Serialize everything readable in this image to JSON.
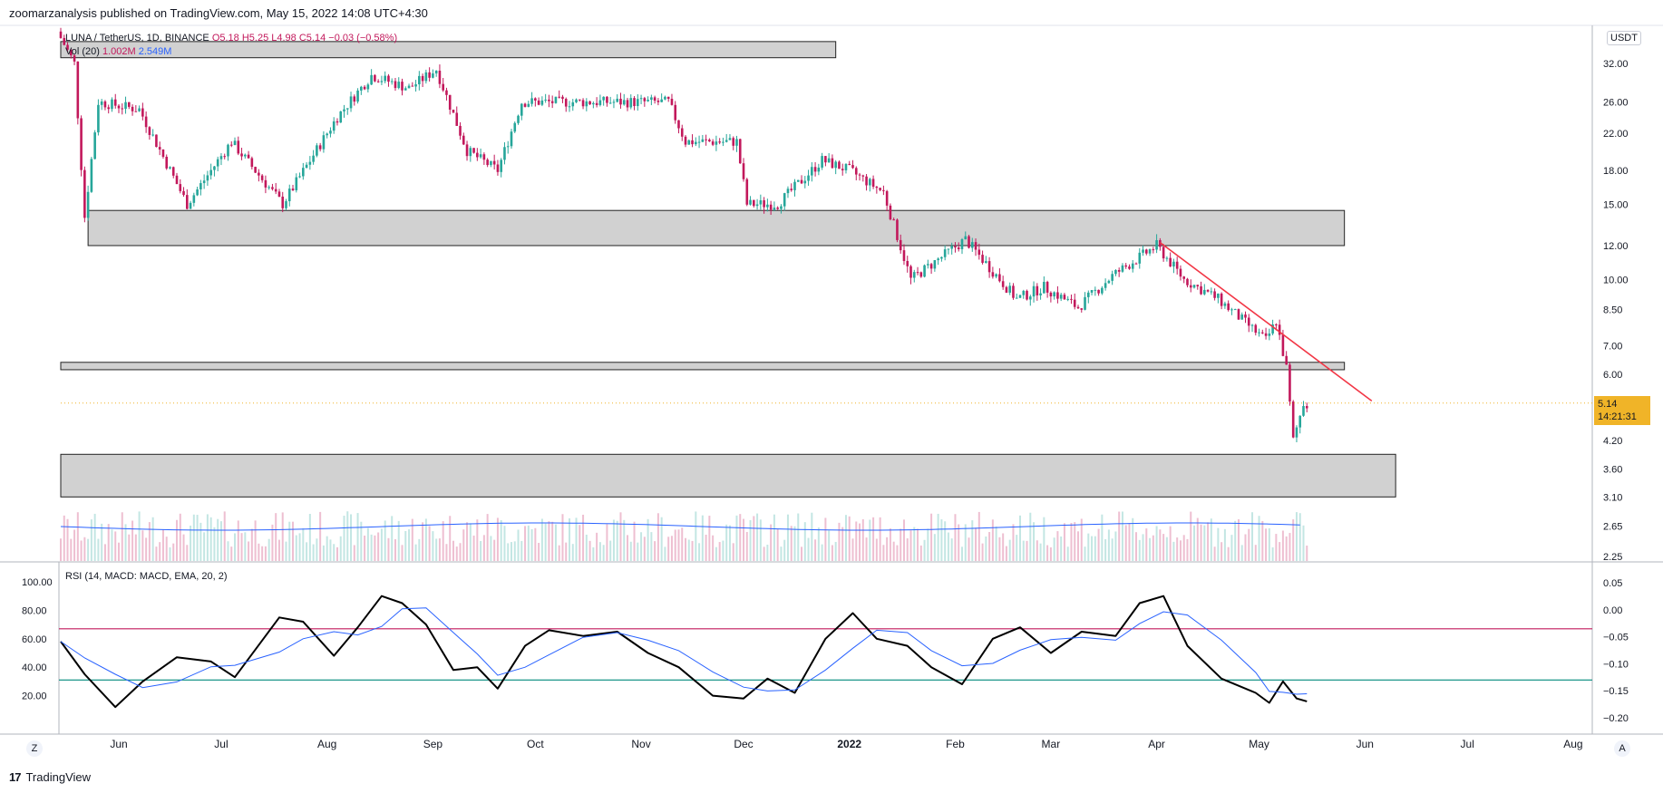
{
  "header": {
    "publisher_line": "zoomarzanalysis published on TradingView.com, May 15, 2022 14:08 UTC+4:30"
  },
  "legend": {
    "symbol": "LUNA / TetherUS, 1D, BINANCE",
    "open": "O5.18",
    "high": "H5.25",
    "low": "L4.98",
    "close": "C5.14",
    "change": "−0.03 (−0.58%)",
    "vol_label": "Vol (20)",
    "vol_value": "1.002M",
    "vol_ma": "2.549M",
    "rsi_label": "RSI (14, MACD: MACD, EMA, 20, 2)"
  },
  "price_axis": {
    "currency": "USDT",
    "last_price": "5.14",
    "countdown": "14:21:31",
    "tick_labels": [
      "32.00",
      "26.00",
      "22.00",
      "18.00",
      "15.00",
      "12.00",
      "10.00",
      "8.50",
      "7.00",
      "6.00",
      "4.20",
      "3.60",
      "3.10",
      "2.65",
      "2.25"
    ]
  },
  "rsi_axis": {
    "left_labels": [
      "100.00",
      "80.00",
      "60.00",
      "40.00",
      "20.00"
    ],
    "right_labels": [
      "0.05",
      "0.00",
      "−0.05",
      "−0.10",
      "−0.15",
      "−0.20"
    ]
  },
  "time_axis": {
    "labels": [
      "Jun",
      "Jul",
      "Aug",
      "Sep",
      "Oct",
      "Nov",
      "Dec",
      "2022",
      "Feb",
      "Mar",
      "Apr",
      "May",
      "Jun",
      "Jul",
      "Aug"
    ]
  },
  "footer": {
    "brand": "TradingView",
    "mark": "17",
    "z_button": "Z",
    "a_button": "A"
  },
  "colors": {
    "up": "#26a69a",
    "down": "#c2185b",
    "trendline": "#f23645",
    "zone_fill": "#d1d1d1",
    "rsi_line": "#000000",
    "rsi_ma": "#2962ff",
    "vol_ma": "#2962ff",
    "level_upper": "#c2185b",
    "level_lower": "#00897b",
    "last_price": "#f0b428"
  },
  "chart_data": {
    "type": "candlestick",
    "title": "LUNA / TetherUS, 1D, BINANCE",
    "ylabel": "USDT",
    "y_scale": "log",
    "ylim": [
      2.25,
      38
    ],
    "x_range": [
      "2021-05-15",
      "2022-08-05"
    ],
    "last_close": 5.14,
    "anchors": [
      [
        "2021-05-15",
        38
      ],
      [
        "2021-05-20",
        32
      ],
      [
        "2021-05-23",
        14
      ],
      [
        "2021-05-27",
        26
      ],
      [
        "2021-06-08",
        25
      ],
      [
        "2021-06-22",
        15
      ],
      [
        "2021-07-05",
        21
      ],
      [
        "2021-07-20",
        15
      ],
      [
        "2021-08-05",
        24
      ],
      [
        "2021-08-15",
        30
      ],
      [
        "2021-08-26",
        28
      ],
      [
        "2021-09-03",
        31
      ],
      [
        "2021-09-12",
        20
      ],
      [
        "2021-09-21",
        18
      ],
      [
        "2021-09-28",
        26
      ],
      [
        "2021-10-15",
        26
      ],
      [
        "2021-10-30",
        26
      ],
      [
        "2021-11-10",
        26
      ],
      [
        "2021-11-15",
        21
      ],
      [
        "2021-11-30",
        21
      ],
      [
        "2021-12-03",
        15
      ],
      [
        "2021-12-12",
        15
      ],
      [
        "2021-12-25",
        19
      ],
      [
        "2022-01-02",
        18
      ],
      [
        "2022-01-12",
        16
      ],
      [
        "2022-01-20",
        10
      ],
      [
        "2022-02-05",
        12.4
      ],
      [
        "2022-02-20",
        9
      ],
      [
        "2022-02-28",
        9.6
      ],
      [
        "2022-03-10",
        8.6
      ],
      [
        "2022-03-20",
        10.2
      ],
      [
        "2022-04-02",
        12
      ],
      [
        "2022-04-10",
        10
      ],
      [
        "2022-04-20",
        9
      ],
      [
        "2022-05-04",
        7.2
      ],
      [
        "2022-05-07",
        8
      ],
      [
        "2022-05-10",
        6.2
      ],
      [
        "2022-05-12",
        4.2
      ],
      [
        "2022-05-15",
        5.14
      ]
    ],
    "support_zones": [
      {
        "from": "2021-05-15",
        "to": "2021-12-28",
        "low": 33,
        "high": 36
      },
      {
        "from": "2021-05-23",
        "to": "2022-05-26",
        "low": 12,
        "high": 14.5
      },
      {
        "from": "2021-05-15",
        "to": "2022-05-26",
        "low": 6.15,
        "high": 6.4
      },
      {
        "from": "2021-05-15",
        "to": "2022-06-10",
        "low": 3.1,
        "high": 3.9
      }
    ],
    "trendline": [
      [
        "2022-04-02",
        12.2
      ],
      [
        "2022-06-03",
        5.2
      ]
    ],
    "volume_ma": "2.549M",
    "rsi": {
      "name": "RSI (14, MACD: MACD, EMA, 20, 2)",
      "ylim": [
        0,
        100
      ],
      "levels": [
        67,
        31
      ],
      "anchors": [
        [
          "2021-05-15",
          58
        ],
        [
          "2021-05-22",
          35
        ],
        [
          "2021-05-31",
          12
        ],
        [
          "2021-06-08",
          30
        ],
        [
          "2021-06-18",
          47
        ],
        [
          "2021-06-28",
          44
        ],
        [
          "2021-07-05",
          33
        ],
        [
          "2021-07-18",
          75
        ],
        [
          "2021-07-25",
          72
        ],
        [
          "2021-08-03",
          48
        ],
        [
          "2021-08-10",
          68
        ],
        [
          "2021-08-17",
          90
        ],
        [
          "2021-08-23",
          85
        ],
        [
          "2021-08-30",
          70
        ],
        [
          "2021-09-07",
          38
        ],
        [
          "2021-09-14",
          40
        ],
        [
          "2021-09-20",
          25
        ],
        [
          "2021-09-28",
          55
        ],
        [
          "2021-10-05",
          66
        ],
        [
          "2021-10-15",
          62
        ],
        [
          "2021-10-25",
          65
        ],
        [
          "2021-11-03",
          50
        ],
        [
          "2021-11-12",
          40
        ],
        [
          "2021-11-22",
          20
        ],
        [
          "2021-12-01",
          18
        ],
        [
          "2021-12-08",
          32
        ],
        [
          "2021-12-16",
          22
        ],
        [
          "2021-12-25",
          60
        ],
        [
          "2022-01-02",
          78
        ],
        [
          "2022-01-09",
          60
        ],
        [
          "2022-01-18",
          55
        ],
        [
          "2022-01-25",
          40
        ],
        [
          "2022-02-03",
          28
        ],
        [
          "2022-02-12",
          60
        ],
        [
          "2022-02-20",
          68
        ],
        [
          "2022-03-01",
          50
        ],
        [
          "2022-03-10",
          65
        ],
        [
          "2022-03-20",
          62
        ],
        [
          "2022-03-27",
          85
        ],
        [
          "2022-04-03",
          90
        ],
        [
          "2022-04-10",
          55
        ],
        [
          "2022-04-20",
          32
        ],
        [
          "2022-04-30",
          22
        ],
        [
          "2022-05-04",
          15
        ],
        [
          "2022-05-08",
          30
        ],
        [
          "2022-05-12",
          18
        ],
        [
          "2022-05-15",
          16
        ]
      ]
    }
  }
}
